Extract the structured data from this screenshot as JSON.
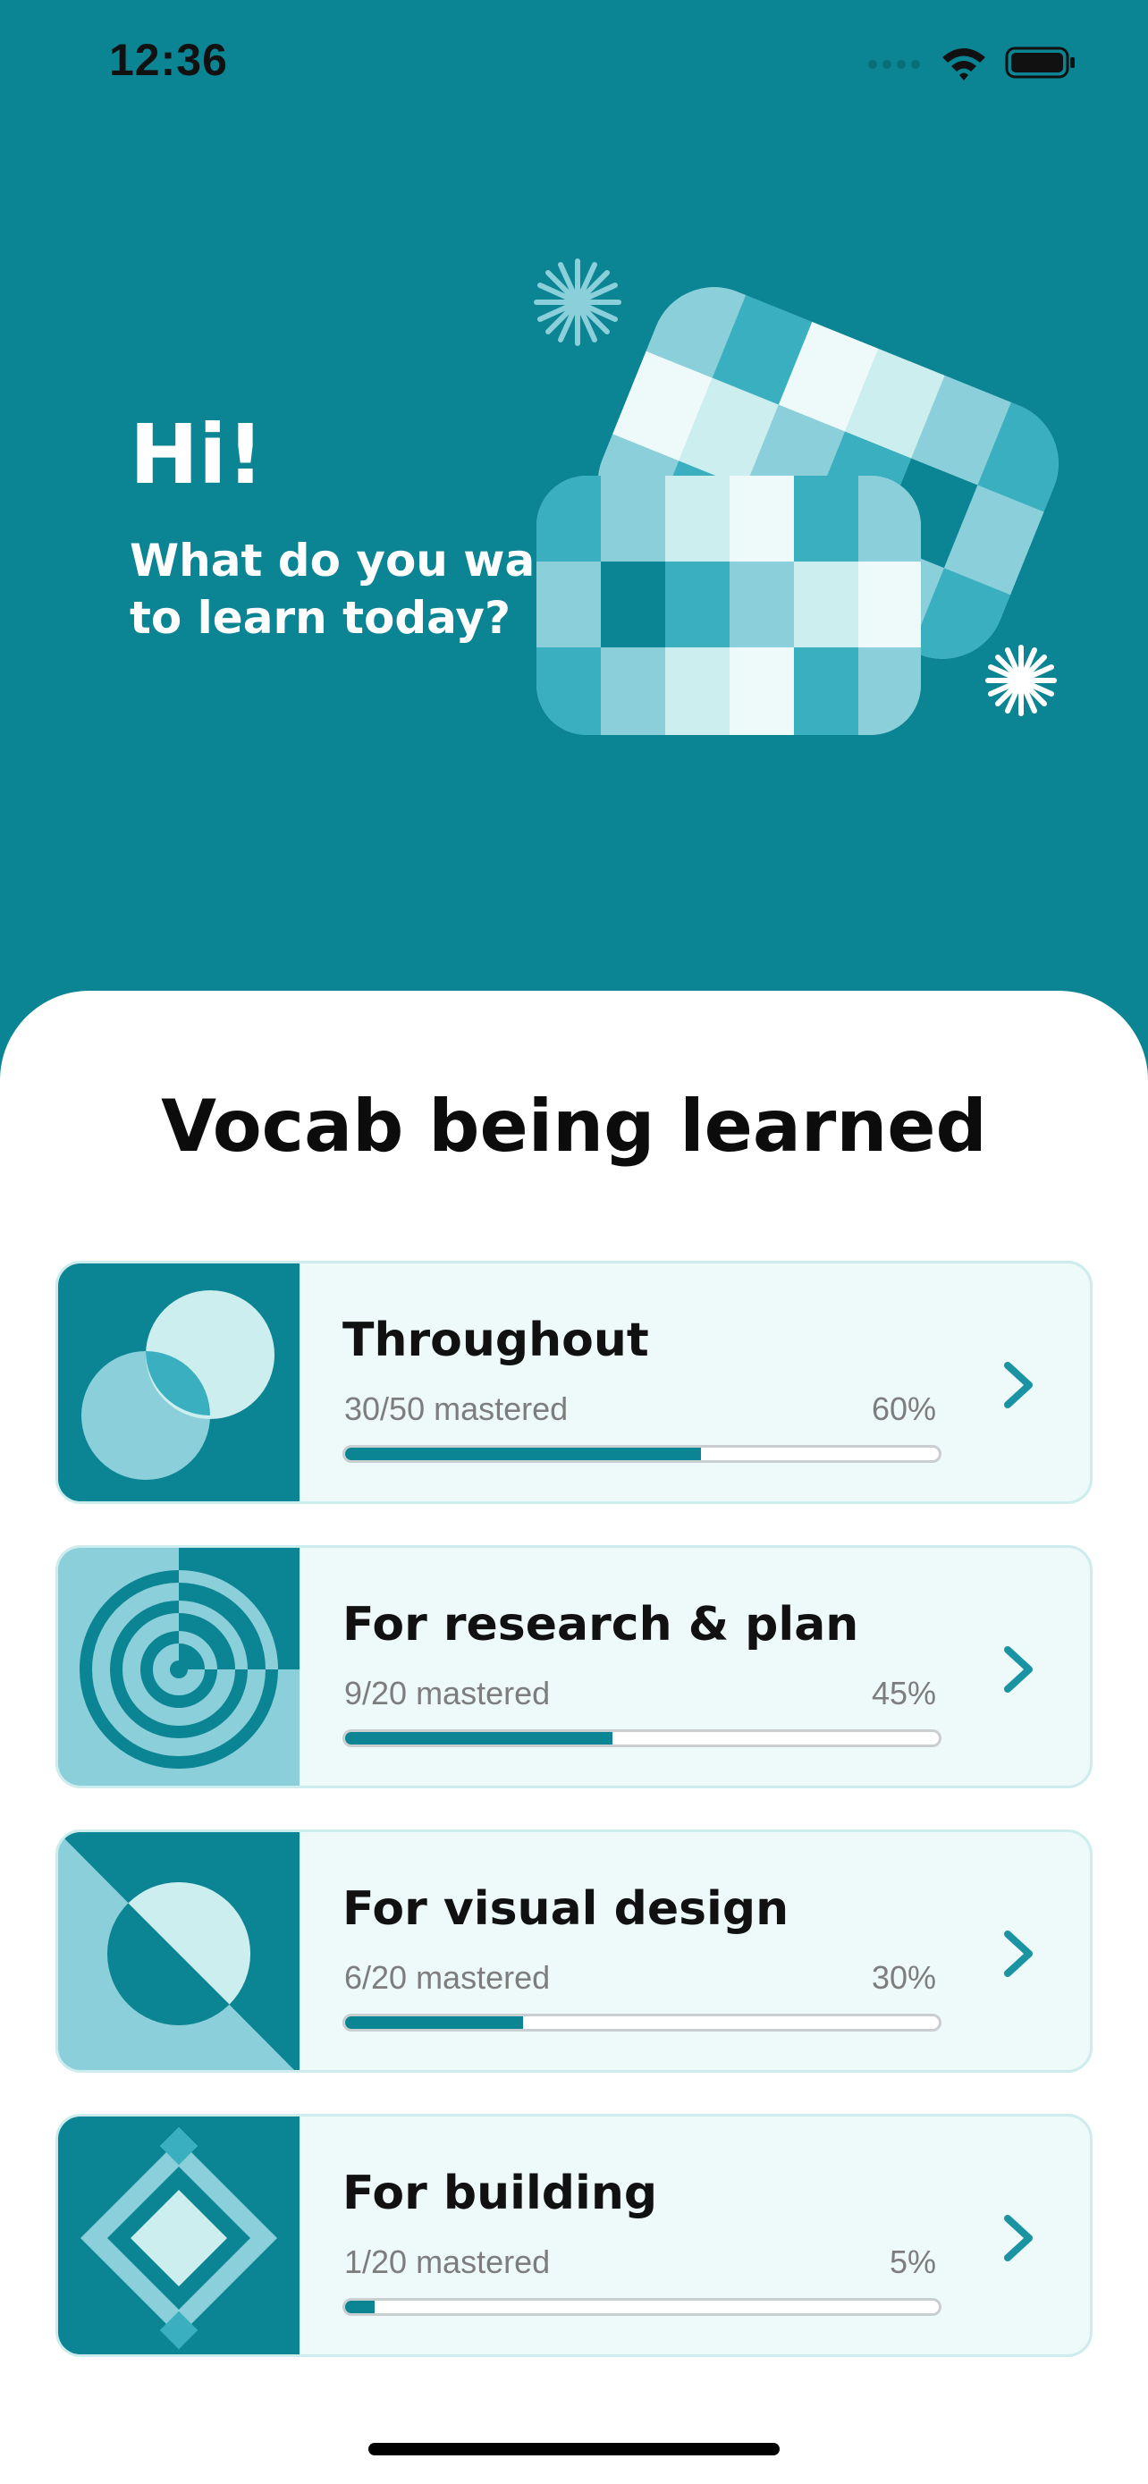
{
  "status_bar": {
    "time": "12:36"
  },
  "hero": {
    "greeting": "Hi!",
    "subtitle": "What do you want to learn today?"
  },
  "section": {
    "title": "Vocab being learned"
  },
  "courses": [
    {
      "title": "Throughout",
      "mastered": "30/50 mastered",
      "percent": "60%",
      "progress": 0.6,
      "thumbnail": "overlapping-circles-icon"
    },
    {
      "title": "For research & plan",
      "mastered": "9/20 mastered",
      "percent": "45%",
      "progress": 0.45,
      "thumbnail": "concentric-target-icon"
    },
    {
      "title": "For visual design",
      "mastered": "6/20 mastered",
      "percent": "30%",
      "progress": 0.3,
      "thumbnail": "split-circle-icon"
    },
    {
      "title": "For building",
      "mastered": "1/20 mastered",
      "percent": "5%",
      "progress": 0.05,
      "thumbnail": "nested-diamonds-icon"
    }
  ],
  "colors": {
    "primary_teal": "#0b8493",
    "light_teal": "#8acfd9",
    "pale_teal": "#cdeeee",
    "card_bg": "#eef9f9"
  }
}
